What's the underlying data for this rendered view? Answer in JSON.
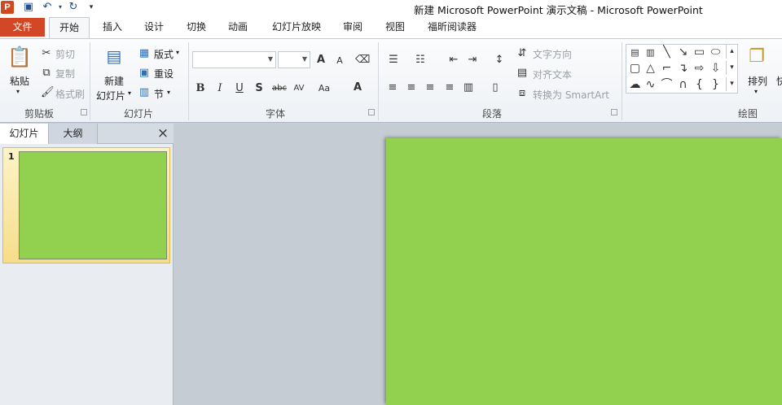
{
  "window": {
    "title": "新建 Microsoft PowerPoint 演示文稿 - Microsoft PowerPoint",
    "app_icon_letter": "P"
  },
  "quick_access": {
    "save_icon": "save-icon",
    "undo_icon": "undo-icon",
    "redo_icon": "redo-icon",
    "customize_icon": "dropdown-icon"
  },
  "tabs": [
    {
      "label": "文件",
      "color": "#d24726"
    },
    {
      "label": "开始"
    },
    {
      "label": "插入"
    },
    {
      "label": "设计"
    },
    {
      "label": "切换"
    },
    {
      "label": "动画"
    },
    {
      "label": "幻灯片放映"
    },
    {
      "label": "审阅"
    },
    {
      "label": "视图"
    },
    {
      "label": "福昕阅读器"
    }
  ],
  "clipboard": {
    "group_label": "剪贴板",
    "paste": "粘贴",
    "cut": "剪切",
    "copy": "复制",
    "format_painter": "格式刷"
  },
  "slides_group": {
    "group_label": "幻灯片",
    "new_slide_line1": "新建",
    "new_slide_line2": "幻灯片",
    "layout": "版式",
    "reset": "重设",
    "section": "节"
  },
  "font": {
    "group_label": "字体",
    "font_name_value": "",
    "font_size_value": "",
    "grow": "A",
    "shrink": "A",
    "bold": "B",
    "italic": "I",
    "underline": "U",
    "shadow": "S",
    "strike": "abc",
    "spacing": "AV",
    "case": "Aa",
    "color": "A"
  },
  "paragraph": {
    "group_label": "段落",
    "text_direction": "文字方向",
    "align_text": "对齐文本",
    "smartart": "转换为 SmartArt"
  },
  "drawing": {
    "group_label": "绘图",
    "arrange": "排列",
    "quick_styles_partial": "快"
  },
  "panel": {
    "tab_slides": "幻灯片",
    "tab_outline": "大纲",
    "close": "×",
    "thumb_number": "1"
  },
  "slide": {
    "background": "#92d050"
  }
}
